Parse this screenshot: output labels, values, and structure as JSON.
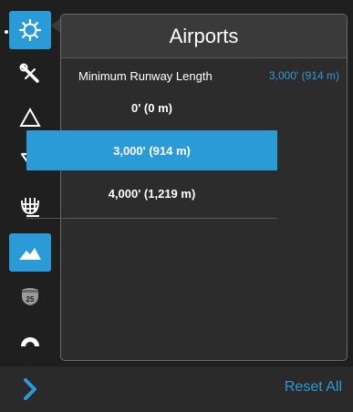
{
  "panel": {
    "title": "Airports"
  },
  "setting": {
    "label": "Minimum Runway Length",
    "value": "3,000' (914 m)"
  },
  "options": [
    {
      "label": "0' (0 m)",
      "selected": false
    },
    {
      "label": "3,000' (914 m)",
      "selected": true
    },
    {
      "label": "4,000' (1,219 m)",
      "selected": false
    }
  ],
  "rail": {
    "items": [
      {
        "icon": "settings-gear-icon",
        "active": true
      },
      {
        "icon": "wrench-icon",
        "active": false
      },
      {
        "icon": "triangle-icon",
        "active": false
      },
      {
        "icon": "funnel-icon",
        "active": false
      },
      {
        "icon": "grid-sphere-icon",
        "active": false
      },
      {
        "icon": "terrain-mountain-icon",
        "active": true
      },
      {
        "icon": "highway-shield-icon",
        "active": false,
        "text": "25"
      },
      {
        "icon": "protractor-icon",
        "active": false
      }
    ]
  },
  "footer": {
    "expand_icon": "chevron-right-icon",
    "reset_label": "Reset All"
  },
  "colors": {
    "accent": "#2b9bd8",
    "background": "#1f1f1f",
    "panel": "#2c2c2c",
    "header": "#3a3a3a"
  }
}
